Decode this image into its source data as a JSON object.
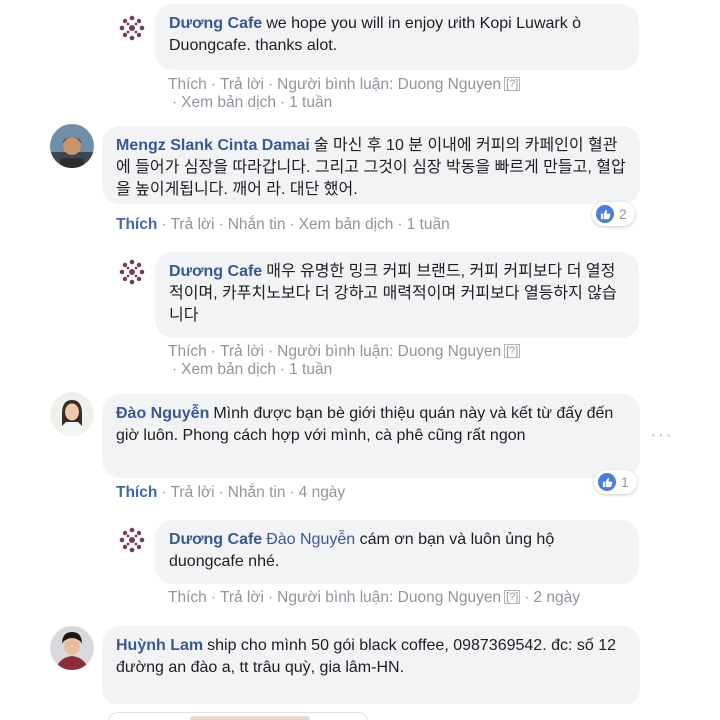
{
  "comments": [
    {
      "author": "Dương Cafe",
      "text": "we hope you will in enjoy ưith Kopi Luwark ò Duongcafe. thanks alot.",
      "actions": {
        "like": "Thích",
        "reply": "Trả lời",
        "commenter": "Người bình luận: Duong Nguyen",
        "help": "[?]",
        "translate": "Xem bản dịch",
        "time": "1 tuần"
      }
    },
    {
      "author": "Mengz Slank Cinta Damai",
      "text": "술 마신 후 10 분 이내에 커피의 카페인이 혈관에 들어가 심장을 따라갑니다. 그리고 그것이 심장 박동을 빠르게 만들고, 혈압을 높이게됩니다. 깨어 라. 대단 했어.",
      "actions": {
        "like": "Thích",
        "reply": "Trả lời",
        "message": "Nhắn tin",
        "translate": "Xem bản dịch",
        "time": "1 tuần"
      },
      "reactions": "2"
    },
    {
      "author": "Dương Cafe",
      "text": "매우 유명한 밍크 커피 브랜드, 커피 커피보다 더 열정적이며, 카푸치노보다 더 강하고 매력적이며 커피보다 열등하지 않습니다",
      "actions": {
        "like": "Thích",
        "reply": "Trả lời",
        "commenter": "Người bình luận: Duong Nguyen",
        "help": "[?]",
        "translate": "Xem bản dịch",
        "time": "1 tuần"
      }
    },
    {
      "author": "Đào Nguyễn",
      "text": "Mình được bạn bè giới thiệu quán này và kết từ đấy đến giờ luôn. Phong cách hợp với mình, cà phê cũng rất ngon",
      "actions": {
        "like": "Thích",
        "reply": "Trả lời",
        "message": "Nhắn tin",
        "time": "4 ngày"
      },
      "reactions": "1"
    },
    {
      "author": "Dương Cafe",
      "tag": "Đào Nguyễn",
      "text": "cám ơn bạn và luôn ủng hộ duongcafe nhé.",
      "actions": {
        "like": "Thích",
        "reply": "Trả lời",
        "commenter": "Người bình luận: Duong Nguyen",
        "help": "[?]",
        "time": "2 ngày"
      }
    },
    {
      "author": "Huỳnh Lam",
      "text": "ship cho mình 50 gói black coffee, 0987369542. đc: số 12 đường an đào a, tt trâu quỳ, gia lâm-HN."
    }
  ],
  "more_options": "···",
  "colors": {
    "link": "#385898",
    "bubble": "#f2f3f5",
    "meta": "#90949c",
    "like": "#4267b2"
  }
}
